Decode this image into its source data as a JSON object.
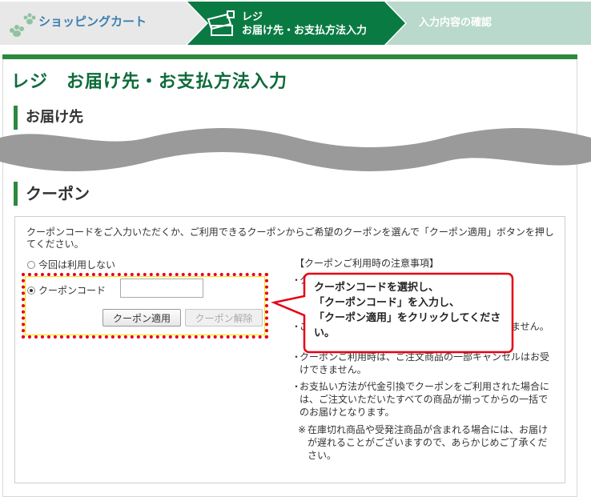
{
  "steps": {
    "step1": "ショッピングカート",
    "step2_line1": "レジ",
    "step2_line2": "お届け先・お支払方法入力",
    "step3": "入力内容の確認"
  },
  "page_title": "レジ　お届け先・お支払方法入力",
  "sections": {
    "address": "お届け先",
    "coupon": "クーポン"
  },
  "coupon": {
    "description": "クーポンコードをご入力いただくか、ご利用できるクーポンからご希望のクーポンを選んで「クーポン適用」ボタンを押してください。",
    "option_none": "今回は利用しない",
    "option_code": "クーポンコード",
    "code_value": "",
    "apply_button": "クーポン適用",
    "cancel_button": "クーポン解除"
  },
  "notes": {
    "title": "【クーポンご利用時の注意事項】",
    "bullet": "・",
    "items": [
      "クーポンはお一人様1回限りご利用いただけます。",
      "他のクーポンとの併用はできません。無効です。",
      "ご注文確定後のクーポンの変更はご利用いただけません。",
      "クーポンご利用時は、ご注文商品の一部キャンセルはお受けできません。",
      "お支払い方法が代金引換でクーポンをご利用された場合には、ご注文いただいたすべての商品が揃ってからの一括でのお届けとなります。"
    ],
    "footnote_mark": "※",
    "footnote": "在庫切れ商品や受発注商品が含まれる場合には、お届けが遅れることがございますので、あらかじめご了承ください。"
  },
  "callout": {
    "line1": "クーポンコードを選択し、",
    "line2": "「クーポンコード」を入力し、",
    "line3": "「クーポン適用」をクリックしてください。"
  },
  "colors": {
    "accent_green": "#2b8a3e",
    "title_green": "#0d6b3a",
    "step1_text": "#3d7fb0",
    "callout_border": "#e60012"
  }
}
